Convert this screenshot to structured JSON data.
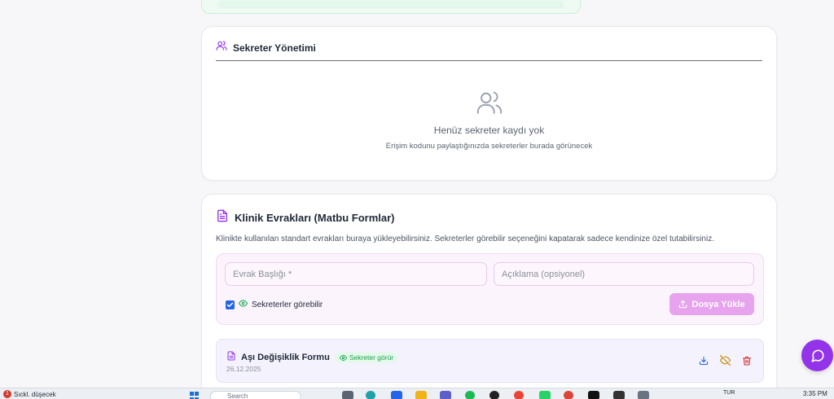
{
  "secretary": {
    "title": "Sekreter Yönetimi",
    "empty_title": "Henüz sekreter kaydı yok",
    "empty_subtitle": "Erişim kodunu paylaştığınızda sekreterler burada görünecek"
  },
  "forms": {
    "title": "Klinik Evrakları (Matbu Formlar)",
    "description": "Klinikte kullanılan standart evrakları buraya yükleyebilirsiniz. Sekreterler görebilir seçeneğini kapatarak sadece kendinize özel tutabilirsiniz.",
    "title_placeholder": "Evrak Başlığı *",
    "description_placeholder": "Açıklama (opsiyonel)",
    "checkbox_label": "Sekreterler görebilir",
    "checkbox_checked": true,
    "upload_label": "Dosya Yükle",
    "documents": [
      {
        "name": "Aşı Değişiklik Formu",
        "badge": "Sekreter görür",
        "date": "26.12.2025"
      }
    ]
  },
  "taskbar": {
    "weather_text": "Sıckl. düşecek",
    "weather_badge": "1",
    "search_placeholder": "Search",
    "lang": "TUR",
    "time": "3:35 PM"
  },
  "colors": {
    "accent": "#9333ea",
    "accent_light": "#e7a3ee",
    "success": "#16a34a",
    "danger": "#dc2626",
    "link_blue": "#2563eb",
    "warning": "#ca8a04"
  }
}
